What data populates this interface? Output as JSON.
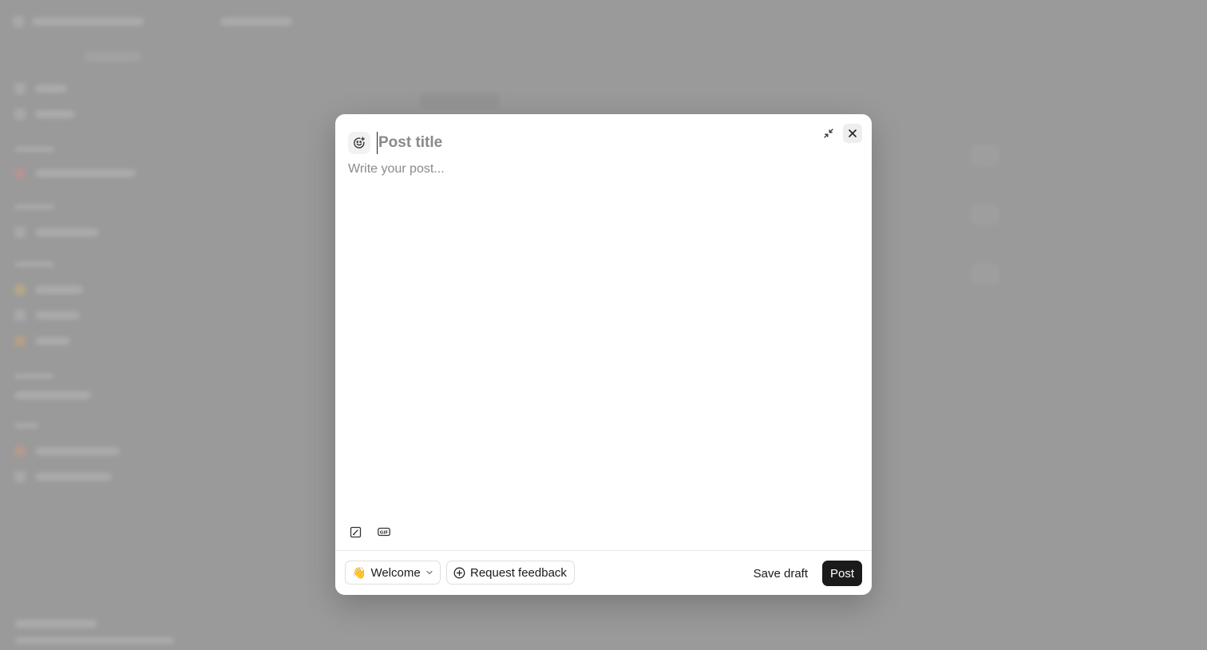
{
  "composer": {
    "title_placeholder": "Post title",
    "body_placeholder": "Write your post...",
    "channel": {
      "emoji": "👋",
      "label": "Welcome"
    },
    "request_feedback_label": "Request feedback",
    "save_draft_label": "Save draft",
    "post_label": "Post"
  },
  "icons": {
    "emoji_picker": "emoji-add-icon",
    "minimize": "minimize-icon",
    "close": "close-icon",
    "canvas": "pencil-square-icon",
    "gif": "gif-icon",
    "channel_chevron": "chevron-down-icon",
    "feedback": "plus-circle-icon"
  },
  "colors": {
    "overlay": "#9a9a9a",
    "primary_button": "#1a1a1a",
    "primary_button_text": "#ffffff",
    "placeholder": "#8a8a8a"
  }
}
